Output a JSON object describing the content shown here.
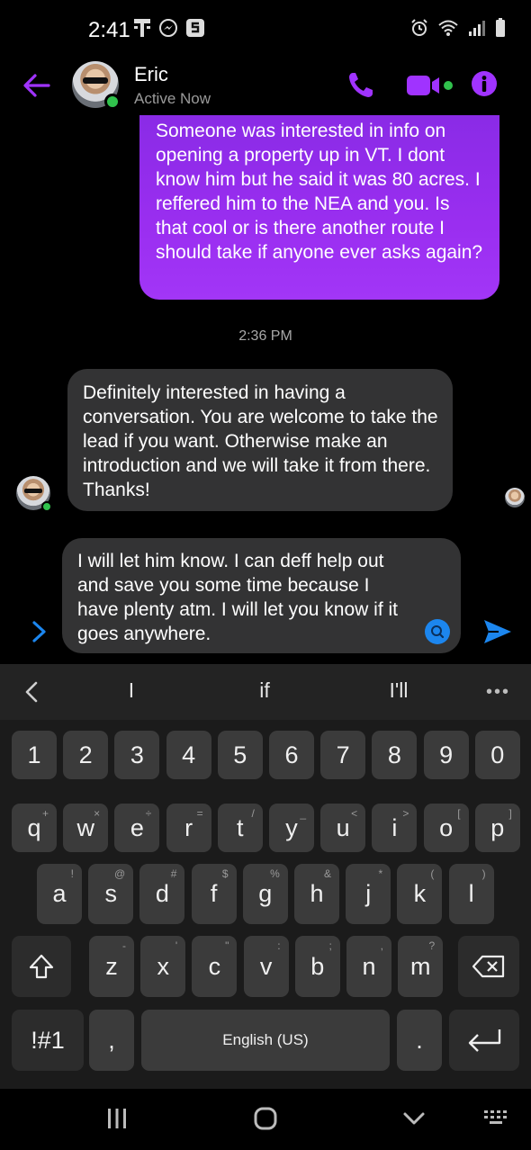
{
  "status_bar": {
    "time": "2:41",
    "left_icons": [
      "t-mobile-icon",
      "messenger-icon",
      "s-app-icon"
    ],
    "right_icons": [
      "alarm-icon",
      "wifi-icon",
      "signal-icon",
      "battery-icon"
    ]
  },
  "header": {
    "contact_name": "Eric",
    "presence": "Active Now",
    "accent_color": "#a033ff",
    "buttons": [
      "back-arrow-icon",
      "phone-icon",
      "video-icon",
      "info-icon"
    ]
  },
  "messages": {
    "outgoing_1": "Someone was interested in info on opening a property up in VT. I dont know him but he said it was 80 acres. I reffered him to the NEA and you. Is that cool  or is there another route I should take if anyone ever asks again?",
    "timestamp": "2:36 PM",
    "incoming_1": "Definitely interested in having a conversation. You are welcome to take the lead if you want. Otherwise make an introduction and we will take it from there. Thanks!"
  },
  "composer": {
    "text": "I will let him know. I can deff help out and save you some time because I have plenty atm. I will let you know if it goes anywhere."
  },
  "keyboard": {
    "suggestions": [
      "I",
      "if",
      "I'll"
    ],
    "more_label": "•••",
    "number_row": [
      "1",
      "2",
      "3",
      "4",
      "5",
      "6",
      "7",
      "8",
      "9",
      "0"
    ],
    "row1": [
      {
        "k": "q",
        "s": "+"
      },
      {
        "k": "w",
        "s": "×"
      },
      {
        "k": "e",
        "s": "÷"
      },
      {
        "k": "r",
        "s": "="
      },
      {
        "k": "t",
        "s": "/"
      },
      {
        "k": "y",
        "s": "_"
      },
      {
        "k": "u",
        "s": "<"
      },
      {
        "k": "i",
        "s": ">"
      },
      {
        "k": "o",
        "s": "["
      },
      {
        "k": "p",
        "s": "]"
      }
    ],
    "row2": [
      {
        "k": "a",
        "s": "!"
      },
      {
        "k": "s",
        "s": "@"
      },
      {
        "k": "d",
        "s": "#"
      },
      {
        "k": "f",
        "s": "$"
      },
      {
        "k": "g",
        "s": "%"
      },
      {
        "k": "h",
        "s": "&"
      },
      {
        "k": "j",
        "s": "*"
      },
      {
        "k": "k",
        "s": "("
      },
      {
        "k": "l",
        "s": ")"
      }
    ],
    "row3": [
      {
        "k": "z",
        "s": "-"
      },
      {
        "k": "x",
        "s": "'"
      },
      {
        "k": "c",
        "s": "\""
      },
      {
        "k": "v",
        "s": ":"
      },
      {
        "k": "b",
        "s": ";"
      },
      {
        "k": "n",
        "s": ","
      },
      {
        "k": "m",
        "s": "?"
      }
    ],
    "symbols_key": "!#1",
    "comma_key": ",",
    "space_label": "English (US)",
    "period_key": "."
  },
  "nav_bar": {
    "buttons": [
      "recents-icon",
      "home-icon",
      "back-chevron-icon",
      "keyboard-icon"
    ]
  }
}
